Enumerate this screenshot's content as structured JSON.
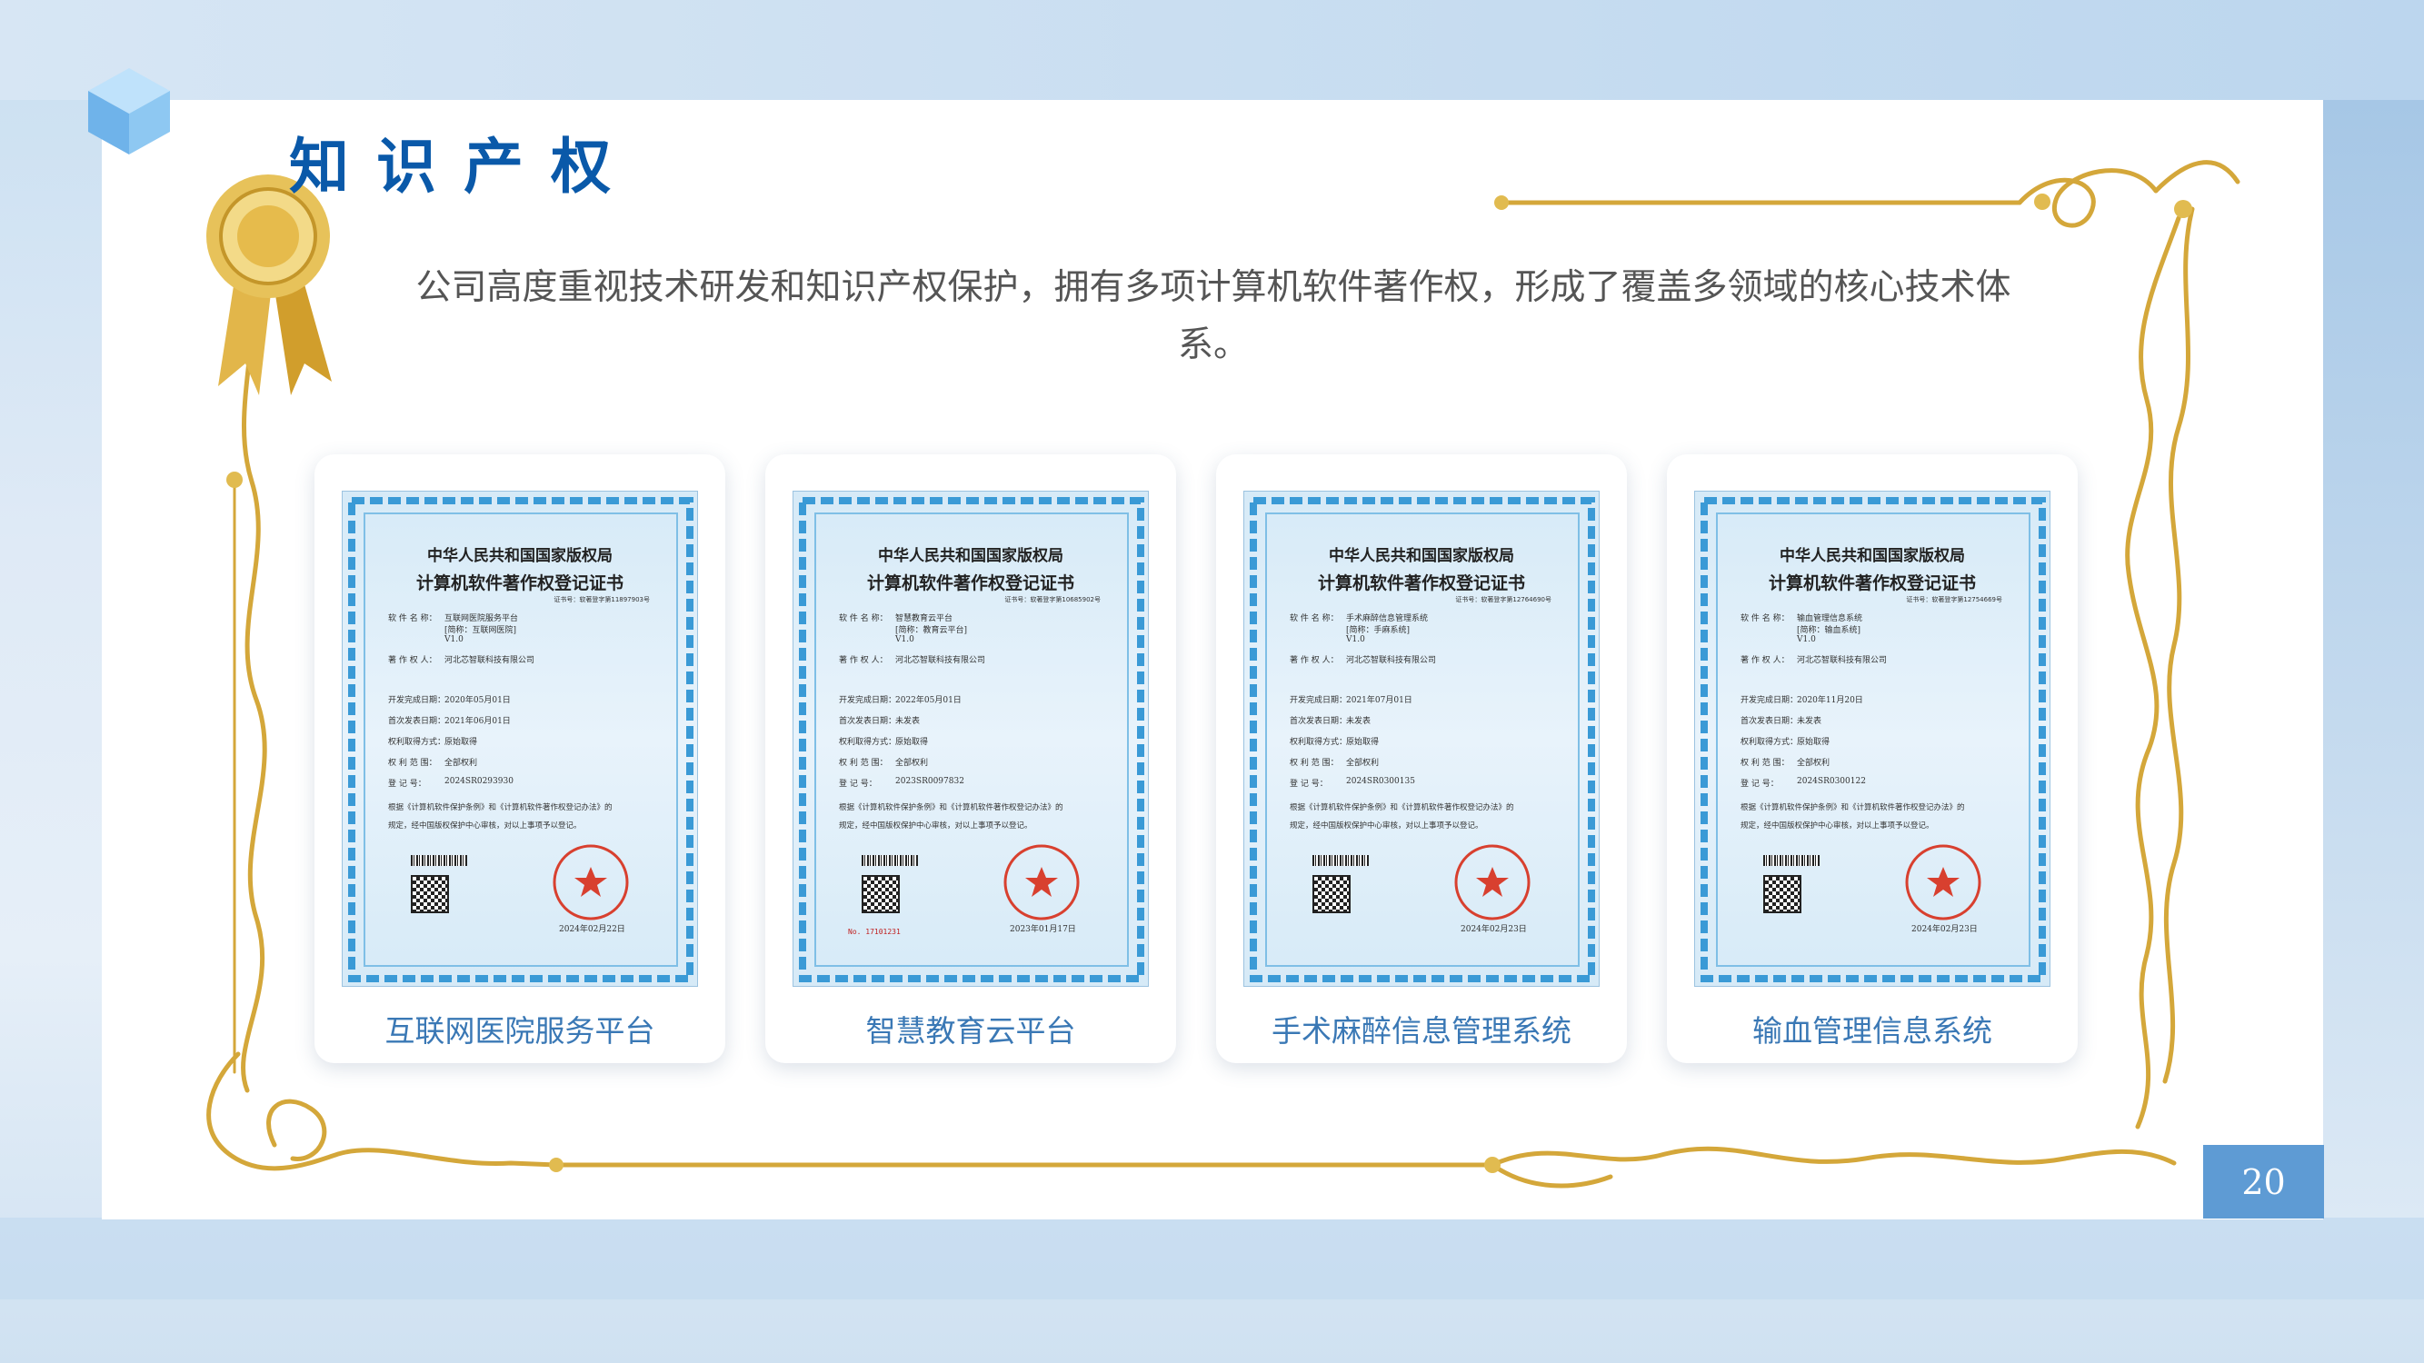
{
  "header": {
    "title": "知识产权"
  },
  "intro": "公司高度重视技术研发和知识产权保护，拥有多项计算机软件著作权，形成了覆盖多领域的核心技术体系。",
  "certificates": [
    {
      "caption": "互联网医院服务平台",
      "org": "中华人民共和国国家版权局",
      "heading": "计算机软件著作权登记证书",
      "cert_no": "证书号：软著登字第11897903号",
      "software_name": "互联网医院服务平台",
      "short_name": "[简称：互联网医院]",
      "version": "V1.0",
      "owner": "河北芯智联科技有限公司",
      "dev_date": "2020年05月01日",
      "pub_date": "2021年06月01日",
      "acquire": "原始取得",
      "scope": "全部权利",
      "reg_no": "2024SR0293930",
      "date": "2024年02月22日"
    },
    {
      "caption": "智慧教育云平台",
      "org": "中华人民共和国国家版权局",
      "heading": "计算机软件著作权登记证书",
      "cert_no": "证书号：软著登字第10685902号",
      "software_name": "智慧教育云平台",
      "short_name": "[简称：教育云平台]",
      "version": "V1.0",
      "owner": "河北芯智联科技有限公司",
      "dev_date": "2022年05月01日",
      "pub_date": "未发表",
      "acquire": "原始取得",
      "scope": "全部权利",
      "reg_no": "2023SR0097832",
      "date": "2023年01月17日",
      "serial": "No. 17101231"
    },
    {
      "caption": "手术麻醉信息管理系统",
      "org": "中华人民共和国国家版权局",
      "heading": "计算机软件著作权登记证书",
      "cert_no": "证书号：软著登字第12764690号",
      "software_name": "手术麻醉信息管理系统",
      "short_name": "[简称：手麻系统]",
      "version": "V1.0",
      "owner": "河北芯智联科技有限公司",
      "dev_date": "2021年07月01日",
      "pub_date": "未发表",
      "acquire": "原始取得",
      "scope": "全部权利",
      "reg_no": "2024SR0300135",
      "date": "2024年02月23日"
    },
    {
      "caption": "输血管理信息系统",
      "org": "中华人民共和国国家版权局",
      "heading": "计算机软件著作权登记证书",
      "cert_no": "证书号：软著登字第12754669号",
      "software_name": "输血管理信息系统",
      "short_name": "[简称：输血系统]",
      "version": "V1.0",
      "owner": "河北芯智联科技有限公司",
      "dev_date": "2020年11月20日",
      "pub_date": "未发表",
      "acquire": "原始取得",
      "scope": "全部权利",
      "reg_no": "2024SR0300122",
      "date": "2024年02月23日"
    }
  ],
  "cert_labels": {
    "name": "软 件 名 称：",
    "owner": "著 作 权 人：",
    "dev": "开发完成日期：",
    "pub": "首次发表日期：",
    "acquire": "权利取得方式：",
    "scope": "权 利 范 围：",
    "reg": "登   记   号：",
    "para1": "根据《计算机软件保护条例》和《计算机软件著作权登记办法》的",
    "para2": "规定，经中国版权保护中心审核，对以上事项予以登记。"
  },
  "page_number": "20",
  "colors": {
    "title": "#0a59a9",
    "caption": "#3a78b5",
    "gold": "#d4a73a",
    "page_box": "#5e9bd4"
  }
}
